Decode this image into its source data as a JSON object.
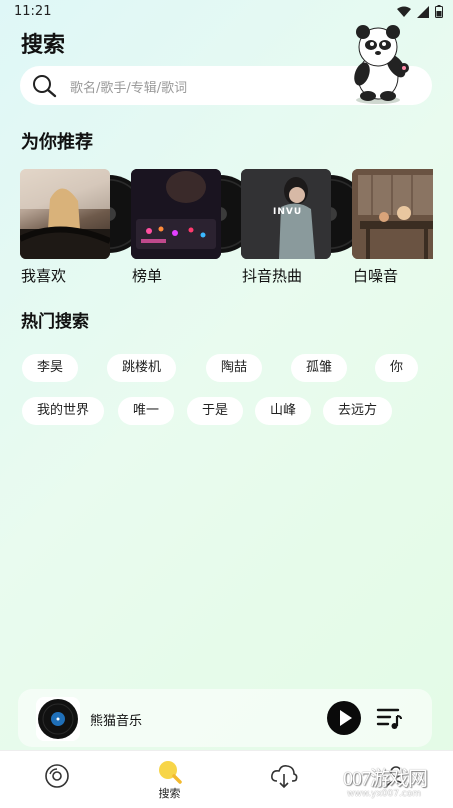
{
  "status": {
    "time": "11:21"
  },
  "header": {
    "title": "搜索"
  },
  "search": {
    "placeholder": "歌名/歌手/专辑/歌词"
  },
  "recommend": {
    "title": "为你推荐",
    "items": [
      {
        "label": "我喜欢"
      },
      {
        "label": "榜单"
      },
      {
        "label": "抖音热曲",
        "cover_text": "INVU"
      },
      {
        "label": "白噪音"
      }
    ]
  },
  "hot": {
    "title": "热门搜索",
    "tags": [
      "李昊",
      "跳楼机",
      "陶喆",
      "孤雏",
      "你",
      "我的世界",
      "唯一",
      "于是",
      "山峰",
      "去远方"
    ]
  },
  "player": {
    "title": "熊猫音乐"
  },
  "nav": {
    "items": [
      {
        "label": "",
        "icon": "disc-icon"
      },
      {
        "label": "搜索",
        "icon": "search-icon"
      },
      {
        "label": "",
        "icon": "cloud-download-icon"
      },
      {
        "label": "",
        "icon": "profile-icon"
      }
    ]
  },
  "watermark": {
    "text": "007游戏网",
    "sub": "www.yx007.com"
  },
  "colors": {
    "accent": "#f7d548",
    "dark": "#0a0a0a"
  }
}
